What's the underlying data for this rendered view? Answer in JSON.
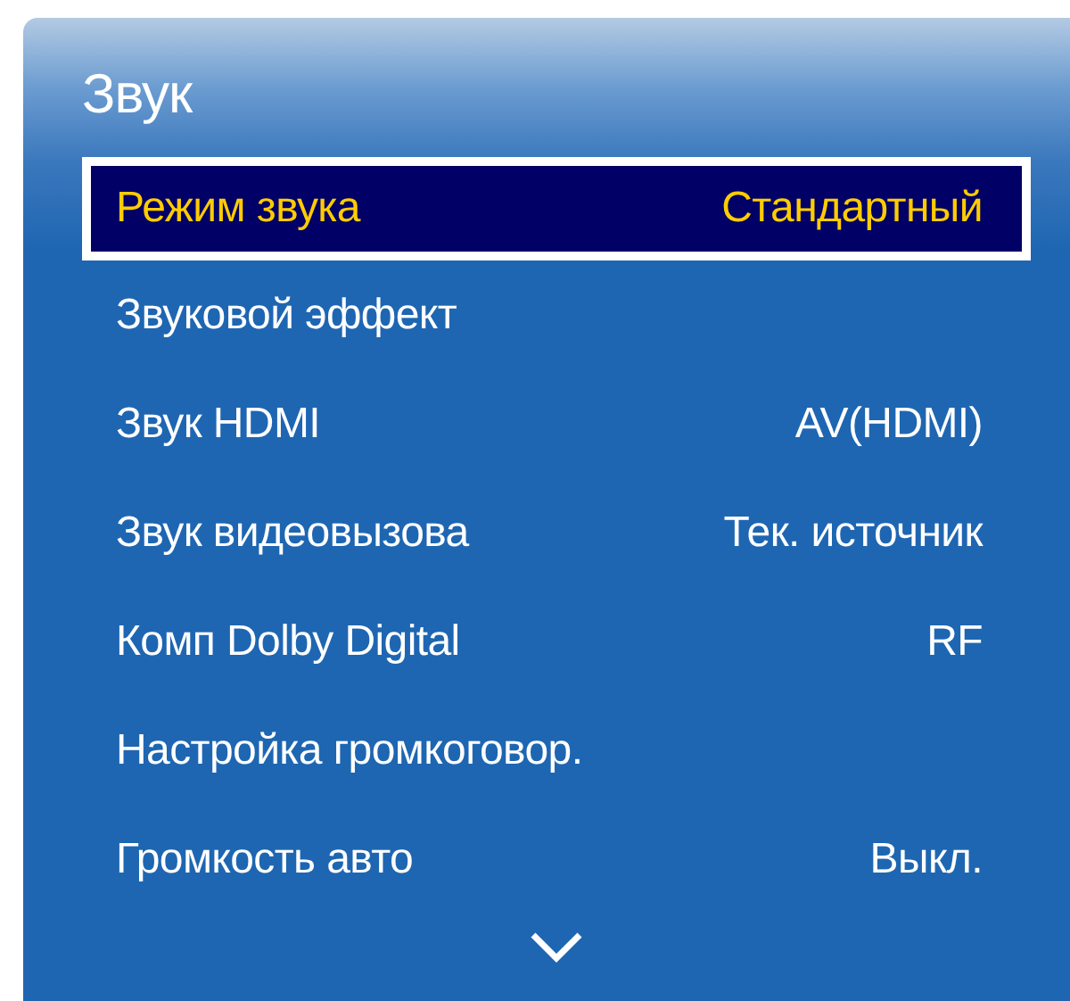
{
  "title": "Звук",
  "items": [
    {
      "label": "Режим звука",
      "value": "Стандартный",
      "selected": true
    },
    {
      "label": "Звуковой эффект",
      "selected": false
    },
    {
      "label": "Звук HDMI",
      "value": "AV(HDMI)",
      "selected": false
    },
    {
      "label": "Звук видеовызова",
      "value": "Тек. источник",
      "selected": false
    },
    {
      "label": "Комп Dolby Digital",
      "value": "RF",
      "selected": false
    },
    {
      "label": "Настройка громкоговор.",
      "selected": false
    },
    {
      "label": "Громкость авто",
      "value": "Выкл.",
      "selected": false
    }
  ]
}
